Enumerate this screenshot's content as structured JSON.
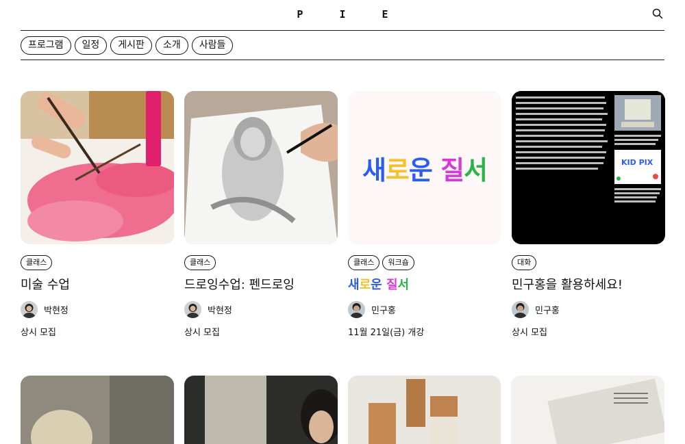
{
  "header": {
    "logo": "P I E",
    "search_icon": "search-icon"
  },
  "nav": {
    "items": [
      "프로그램",
      "일정",
      "게시판",
      "소개",
      "사람들"
    ]
  },
  "cards": [
    {
      "tags": [
        "클래스"
      ],
      "title": "미술 수업",
      "author": "박현정",
      "schedule": "상시 모집"
    },
    {
      "tags": [
        "클래스"
      ],
      "title": "드로잉수업: 펜드로잉",
      "author": "박현정",
      "schedule": "상시 모집"
    },
    {
      "tags": [
        "클래스",
        "워크숍"
      ],
      "title": "새로운 질서",
      "author": "민구홍",
      "schedule": "11월 21일(금) 개강",
      "thumb_text": "새로운 질서",
      "rainbow_colors": [
        "#2b5cf0",
        "#f2c12e",
        "#2b5cf0",
        "#d53ad9",
        "#2bb34a",
        "#f23a2b"
      ]
    },
    {
      "tags": [
        "대화"
      ],
      "title": "민구홍을 활용하세요!",
      "author": "민구홍",
      "schedule": "상시 모집",
      "thumb_logo": "KID PIX"
    }
  ]
}
